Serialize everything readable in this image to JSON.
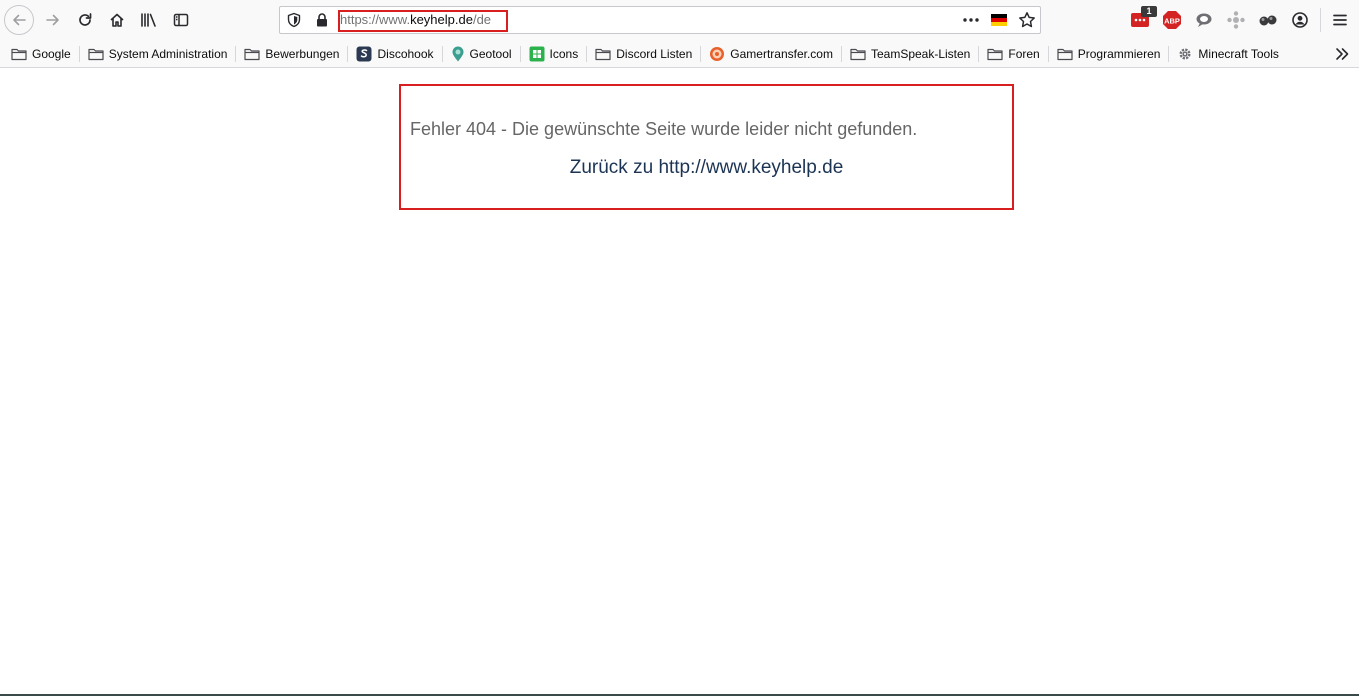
{
  "toolbar": {
    "url": {
      "scheme": "https://www.",
      "host": "keyhelp.de",
      "path": "/de"
    },
    "extension_badge": "1",
    "abp_label": "ABP"
  },
  "bookmarks": [
    {
      "label": "Google",
      "icon": "folder-icon"
    },
    {
      "label": "System Administration",
      "icon": "folder-icon"
    },
    {
      "label": "Bewerbungen",
      "icon": "folder-icon"
    },
    {
      "label": "Discohook",
      "icon": "discohook-icon"
    },
    {
      "label": "Geotool",
      "icon": "geotool-icon"
    },
    {
      "label": "Icons",
      "icon": "icons-site-icon"
    },
    {
      "label": "Discord Listen",
      "icon": "folder-icon"
    },
    {
      "label": "Gamertransfer.com",
      "icon": "gamertransfer-icon"
    },
    {
      "label": "TeamSpeak-Listen",
      "icon": "folder-icon"
    },
    {
      "label": "Foren",
      "icon": "folder-icon"
    },
    {
      "label": "Programmieren",
      "icon": "folder-icon"
    },
    {
      "label": "Minecraft Tools",
      "icon": "gear-icon"
    }
  ],
  "page": {
    "error_message": "Fehler 404 - Die gewünschte Seite wurde leider nicht gefunden.",
    "back_prefix": "Zurück zu ",
    "back_link": "http://www.keyhelp.de"
  },
  "colors": {
    "highlight_border": "#d81e1e",
    "link": "#1c3454",
    "message_text": "#666666",
    "toolbar_bg": "#f9f9fa"
  }
}
